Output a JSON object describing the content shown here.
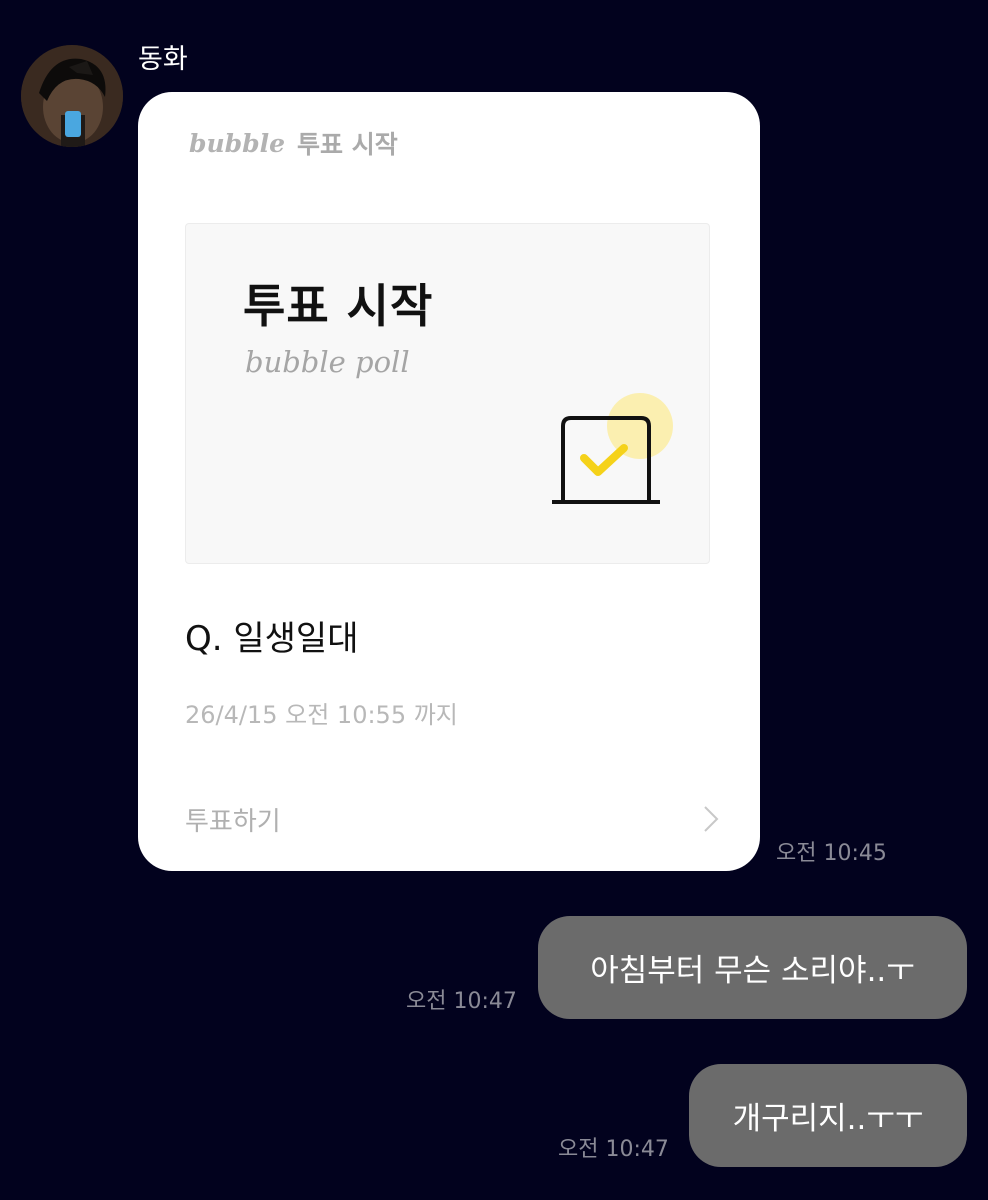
{
  "sender": {
    "name": "동화"
  },
  "poll_message": {
    "brand": "bubble",
    "header_title": "투표 시작",
    "banner_title": "투표 시작",
    "banner_subtitle": "bubble poll",
    "question": "Q. 일생일대",
    "deadline": "26/4/15 오전 10:55 까지",
    "vote_label": "투표하기",
    "time": "오전 10:45",
    "icon": "ballot-check-icon",
    "accent_color": "#f5d21a"
  },
  "sent_messages": [
    {
      "text": "아침부터 무슨 소리야..ㅜ",
      "time": "오전 10:47"
    },
    {
      "text": "개구리지..ㅜㅜ",
      "time": "오전 10:47"
    }
  ],
  "colors": {
    "background": "#02021e",
    "card": "#ffffff",
    "outgoing_bubble": "#6b6b6b"
  }
}
